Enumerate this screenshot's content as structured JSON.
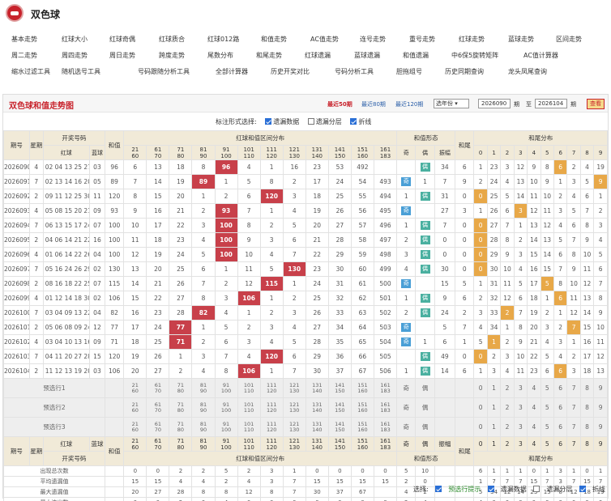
{
  "app": {
    "title": "双色球"
  },
  "nav": [
    [
      "基本走势",
      "红球大小",
      "红球奇偶",
      "红球质合",
      "红球012路",
      "和值走势",
      "AC值走势",
      "连号走势",
      "重号走势",
      "红球走势",
      "蓝球走势",
      "区间走势"
    ],
    [
      "周二走势",
      "周四走势",
      "周日走势",
      "跨度走势",
      "尾数分布",
      "和尾走势",
      "红球遗漏",
      "蓝球遗漏",
      "和值遗漏",
      "中6保5旋转矩阵",
      "AC值计算器"
    ],
    [
      "缩水过滤工具",
      "随机选号工具",
      "号码跟随分析工具",
      "全部计算器",
      "历史开奖对比",
      "号码分析工具",
      "胆拖组号",
      "历史同期查询",
      "龙头凤尾查询"
    ]
  ],
  "panel": {
    "title": "双色球和值走势图",
    "recent": [
      "最近50期",
      "最近80期",
      "最近120期"
    ],
    "select": "选年份",
    "from": "2026090",
    "qi1": "期",
    "to_label": "至",
    "to": "2026104",
    "qi2": "期",
    "query": "查看"
  },
  "options": {
    "label": "标注形式选择:",
    "items": [
      "遗漏数据",
      "遗漏分层",
      "折线"
    ],
    "checked": [
      true,
      false,
      true
    ]
  },
  "header": {
    "period": "期号",
    "dow": "星期",
    "draw": "开奖号码",
    "red": "红球",
    "blue": "蓝球",
    "sum": "和值",
    "dist": "红球和值区间分布",
    "form": "和值形态",
    "odd": "奇",
    "even": "偶",
    "amp": "振幅",
    "tail": "和尾",
    "taildist": "和尾分布",
    "ranges": [
      [
        "21",
        "60"
      ],
      [
        "61",
        "70"
      ],
      [
        "71",
        "80"
      ],
      [
        "81",
        "90"
      ],
      [
        "91",
        "100"
      ],
      [
        "101",
        "110"
      ],
      [
        "111",
        "120"
      ],
      [
        "121",
        "130"
      ],
      [
        "131",
        "140"
      ],
      [
        "141",
        "150"
      ],
      [
        "151",
        "160"
      ],
      [
        "161",
        "183"
      ]
    ],
    "digits": [
      "0",
      "1",
      "2",
      "3",
      "4",
      "5",
      "6",
      "7",
      "8",
      "9"
    ]
  },
  "rows": [
    {
      "p": "2026090",
      "w": "4",
      "r": "02 04 13 25 27 27",
      "b": "03",
      "s": "96",
      "c": [
        "6",
        "13",
        "18",
        "8",
        "96",
        "4",
        "1",
        "16",
        "23",
        "53",
        "492",
        ""
      ],
      "h": 4,
      "oe": "偶",
      "ov": "",
      "amp": "34",
      "t": "6",
      "td": [
        "1",
        "23",
        "3",
        "12",
        "9",
        "8",
        "6",
        "2",
        "4",
        "19"
      ],
      "tdh": 6
    },
    {
      "p": "2026091",
      "w": "7",
      "r": "02 13 14 16 20 24",
      "b": "05",
      "s": "89",
      "c": [
        "7",
        "14",
        "19",
        "89",
        "1",
        "5",
        "8",
        "2",
        "17",
        "24",
        "54",
        "493"
      ],
      "h": 3,
      "oe": "奇",
      "ov": "1",
      "amp": "7",
      "t": "9",
      "td": [
        "2",
        "24",
        "4",
        "13",
        "10",
        "9",
        "1",
        "3",
        "5",
        "9"
      ],
      "tdh": 9
    },
    {
      "p": "2026092",
      "w": "2",
      "r": "09 11 12 25 30 33",
      "b": "11",
      "s": "120",
      "c": [
        "8",
        "15",
        "20",
        "1",
        "2",
        "6",
        "120",
        "3",
        "18",
        "25",
        "55",
        "494"
      ],
      "h": 6,
      "oe": "偶",
      "ov": "1",
      "amp": "31",
      "t": "0",
      "td": [
        "0",
        "25",
        "5",
        "14",
        "11",
        "10",
        "2",
        "4",
        "6",
        "1"
      ],
      "tdh": 0
    },
    {
      "p": "2026093",
      "w": "4",
      "r": "05 08 15 20 21 24",
      "b": "09",
      "s": "93",
      "c": [
        "9",
        "16",
        "21",
        "2",
        "93",
        "7",
        "1",
        "4",
        "19",
        "26",
        "56",
        "495"
      ],
      "h": 4,
      "oe": "奇",
      "ov": "",
      "amp": "27",
      "t": "3",
      "td": [
        "1",
        "26",
        "6",
        "3",
        "12",
        "11",
        "3",
        "5",
        "7",
        "2"
      ],
      "tdh": 3
    },
    {
      "p": "2026094",
      "w": "7",
      "r": "06 13 15 17 24 25",
      "b": "07",
      "s": "100",
      "c": [
        "10",
        "17",
        "22",
        "3",
        "100",
        "8",
        "2",
        "5",
        "20",
        "27",
        "57",
        "496"
      ],
      "h": 4,
      "oe": "偶",
      "ov": "1",
      "amp": "7",
      "t": "0",
      "td": [
        "0",
        "27",
        "7",
        "1",
        "13",
        "12",
        "4",
        "6",
        "8",
        "3"
      ],
      "tdh": 0
    },
    {
      "p": "2026095",
      "w": "2",
      "r": "04 06 14 21 22 33",
      "b": "16",
      "s": "100",
      "c": [
        "11",
        "18",
        "23",
        "4",
        "100",
        "9",
        "3",
        "6",
        "21",
        "28",
        "58",
        "497"
      ],
      "h": 4,
      "oe": "偶",
      "ov": "2",
      "amp": "0",
      "t": "0",
      "td": [
        "0",
        "28",
        "8",
        "2",
        "14",
        "13",
        "5",
        "7",
        "9",
        "4"
      ],
      "tdh": 0
    },
    {
      "p": "2026096",
      "w": "4",
      "r": "01 06 14 22 26 31",
      "b": "04",
      "s": "100",
      "c": [
        "12",
        "19",
        "24",
        "5",
        "100",
        "10",
        "4",
        "7",
        "22",
        "29",
        "59",
        "498"
      ],
      "h": 4,
      "oe": "偶",
      "ov": "3",
      "amp": "0",
      "t": "0",
      "td": [
        "0",
        "29",
        "9",
        "3",
        "15",
        "14",
        "6",
        "8",
        "10",
        "5"
      ],
      "tdh": 0
    },
    {
      "p": "2026097",
      "w": "7",
      "r": "05 16 24 26 29 30",
      "b": "02",
      "s": "130",
      "c": [
        "13",
        "20",
        "25",
        "6",
        "1",
        "11",
        "5",
        "130",
        "23",
        "30",
        "60",
        "499"
      ],
      "h": 7,
      "oe": "偶",
      "ov": "4",
      "amp": "30",
      "t": "0",
      "td": [
        "0",
        "30",
        "10",
        "4",
        "16",
        "15",
        "7",
        "9",
        "11",
        "6"
      ],
      "tdh": 0
    },
    {
      "p": "2026098",
      "w": "2",
      "r": "08 16 18 22 25 26",
      "b": "07",
      "s": "115",
      "c": [
        "14",
        "21",
        "26",
        "7",
        "2",
        "12",
        "115",
        "1",
        "24",
        "31",
        "61",
        "500"
      ],
      "h": 6,
      "oe": "奇",
      "ov": "",
      "amp": "15",
      "t": "5",
      "td": [
        "1",
        "31",
        "11",
        "5",
        "17",
        "5",
        "8",
        "10",
        "12",
        "7"
      ],
      "tdh": 5
    },
    {
      "p": "2026099",
      "w": "4",
      "r": "01 12 14 18 30 31",
      "b": "02",
      "s": "106",
      "c": [
        "15",
        "22",
        "27",
        "8",
        "3",
        "106",
        "1",
        "2",
        "25",
        "32",
        "62",
        "501"
      ],
      "h": 5,
      "oe": "偶",
      "ov": "1",
      "amp": "9",
      "t": "6",
      "td": [
        "2",
        "32",
        "12",
        "6",
        "18",
        "1",
        "6",
        "11",
        "13",
        "8"
      ],
      "tdh": 6
    },
    {
      "p": "2026100",
      "w": "7",
      "r": "03 04 09 13 22 31",
      "b": "04",
      "s": "82",
      "c": [
        "16",
        "23",
        "28",
        "82",
        "4",
        "1",
        "2",
        "3",
        "26",
        "33",
        "63",
        "502"
      ],
      "h": 3,
      "oe": "偶",
      "ov": "2",
      "amp": "24",
      "t": "2",
      "td": [
        "3",
        "33",
        "2",
        "7",
        "19",
        "2",
        "1",
        "12",
        "14",
        "9"
      ],
      "tdh": 2
    },
    {
      "p": "2026101",
      "w": "2",
      "r": "05 06 08 09 24 25",
      "b": "12",
      "s": "77",
      "c": [
        "17",
        "24",
        "77",
        "1",
        "5",
        "2",
        "3",
        "4",
        "27",
        "34",
        "64",
        "503"
      ],
      "h": 2,
      "oe": "奇",
      "ov": "",
      "amp": "5",
      "t": "7",
      "td": [
        "4",
        "34",
        "1",
        "8",
        "20",
        "3",
        "2",
        "7",
        "15",
        "10"
      ],
      "tdh": 7
    },
    {
      "p": "2026102",
      "w": "4",
      "r": "03 04 10 13 16 25",
      "b": "09",
      "s": "71",
      "c": [
        "18",
        "25",
        "71",
        "2",
        "6",
        "3",
        "4",
        "5",
        "28",
        "35",
        "65",
        "504"
      ],
      "h": 2,
      "oe": "奇",
      "ov": "1",
      "amp": "6",
      "t": "1",
      "td": [
        "5",
        "1",
        "2",
        "9",
        "21",
        "4",
        "3",
        "1",
        "16",
        "11"
      ],
      "tdh": 1
    },
    {
      "p": "2026103",
      "w": "7",
      "r": "04 11 20 27 28 30",
      "b": "15",
      "s": "120",
      "c": [
        "19",
        "26",
        "1",
        "3",
        "7",
        "4",
        "120",
        "6",
        "29",
        "36",
        "66",
        "505"
      ],
      "h": 6,
      "oe": "偶",
      "ov": "",
      "amp": "49",
      "t": "0",
      "td": [
        "0",
        "2",
        "3",
        "10",
        "22",
        "5",
        "4",
        "2",
        "17",
        "12"
      ],
      "tdh": 0
    },
    {
      "p": "2026104",
      "w": "2",
      "r": "11 12 13 19 20 31",
      "b": "03",
      "s": "106",
      "c": [
        "20",
        "27",
        "2",
        "4",
        "8",
        "106",
        "1",
        "7",
        "30",
        "37",
        "67",
        "506"
      ],
      "h": 5,
      "oe": "偶",
      "ov": "1",
      "amp": "14",
      "t": "6",
      "td": [
        "1",
        "3",
        "4",
        "11",
        "23",
        "6",
        "6",
        "3",
        "18",
        "13"
      ],
      "tdh": 6
    }
  ],
  "pre": [
    "预选行1",
    "预选行2",
    "预选行3"
  ],
  "stats": [
    {
      "l": "出现总次数",
      "c": [
        "0",
        "0",
        "2",
        "2",
        "5",
        "2",
        "3",
        "1",
        "0",
        "0",
        "0",
        "0"
      ],
      "oe": [
        "5",
        "10"
      ],
      "amp": "",
      "t": "",
      "td": [
        "6",
        "1",
        "1",
        "1",
        "0",
        "1",
        "3",
        "1",
        "0",
        "1"
      ]
    },
    {
      "l": "平均遗漏值",
      "c": [
        "15",
        "15",
        "4",
        "4",
        "2",
        "4",
        "3",
        "7",
        "15",
        "15",
        "15",
        "15"
      ],
      "oe": [
        "2",
        "0"
      ],
      "amp": "",
      "t": "",
      "td": [
        "1",
        "7",
        "7",
        "7",
        "15",
        "7",
        "3",
        "7",
        "15",
        "7"
      ]
    },
    {
      "l": "最大遗漏值",
      "c": [
        "20",
        "27",
        "28",
        "8",
        "8",
        "12",
        "8",
        "7",
        "30",
        "37",
        "67",
        ""
      ],
      "oe": [
        "4",
        "2"
      ],
      "amp": "",
      "t": "",
      "td": [
        "5",
        "34",
        "12",
        "14",
        "23",
        "15",
        "8",
        "12",
        "18",
        "19"
      ]
    },
    {
      "l": "最大连出数",
      "c": [
        "0",
        "0",
        "2",
        "0",
        "4",
        "0",
        "0",
        "0",
        "0",
        "0",
        "0",
        "0"
      ],
      "oe": [
        "2",
        "4"
      ],
      "amp": "",
      "t": "",
      "td": [
        "4",
        "0",
        "0",
        "0",
        "0",
        "0",
        "0",
        "0",
        "0",
        "0"
      ]
    }
  ],
  "bottom": {
    "label": "选择:",
    "items": [
      "预选行提示",
      "遗漏数据",
      "遗漏分层",
      "折线"
    ],
    "checked": [
      true,
      true,
      false,
      true
    ]
  }
}
